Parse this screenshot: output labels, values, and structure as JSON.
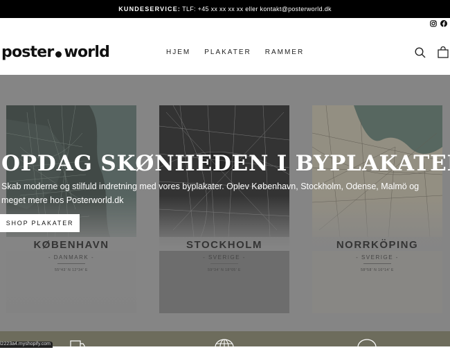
{
  "announcement": {
    "label": "KUNDESERVICE:",
    "text": "TLF: +45 xx xx xx xx eller kontakt@posterworld.dk"
  },
  "social": {
    "instagram": "instagram-icon",
    "facebook": "facebook-icon"
  },
  "header": {
    "logo_left": "poster",
    "logo_right": "world",
    "nav": [
      "HJEM",
      "PLAKATER",
      "RAMMER"
    ],
    "search_icon": "search-icon",
    "cart_icon": "bag-icon"
  },
  "hero": {
    "title": "OPDAG SKØNHEDEN I BYPLAKATER",
    "subtitle": "Skab moderne og stilfuld indretning med vores byplakater. Oplev København, Stockholm, Odense, Malmö og meget mere hos Posterworld.dk",
    "button": "SHOP PLAKATER",
    "posters": [
      {
        "city": "KØBENHAVN",
        "country": "- DANMARK -",
        "coords": "55°43' N 12°34' E",
        "map_color": "#3c4a45"
      },
      {
        "city": "STOCKHOLM",
        "country": "- SVERIGE -",
        "coords": "59°34' N 18°05' E",
        "map_color": "#232323"
      },
      {
        "city": "NORRKÖPING",
        "country": "- SVERIGE -",
        "coords": "58°58' N 16°14' E",
        "map_color": "#a9a293"
      }
    ]
  },
  "footer_strip": {
    "status_url": "l2223a4.myshopify.com",
    "icons": [
      "truck-icon",
      "globe-icon",
      "circle-icon"
    ]
  },
  "colors": {
    "topbar": "#000000",
    "hero_bg": "#8a8a8a",
    "strip": "#6d6c5c"
  }
}
